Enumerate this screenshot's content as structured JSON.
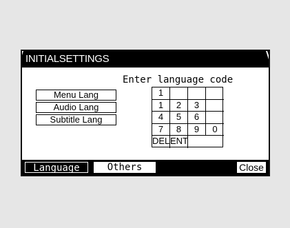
{
  "window": {
    "title": "INITIALSETTINGS"
  },
  "prompt": "Enter language code",
  "language_buttons": [
    {
      "label": "Menu Lang"
    },
    {
      "label": "Audio Lang"
    },
    {
      "label": "Subtitle Lang"
    }
  ],
  "keypad": {
    "rows": [
      [
        "1",
        "",
        "",
        ""
      ],
      [
        "1",
        "2",
        "3",
        ""
      ],
      [
        "4",
        "5",
        "6",
        ""
      ],
      [
        "7",
        "8",
        "9",
        "0"
      ],
      [
        "DEL",
        "ENT"
      ]
    ]
  },
  "tabs": [
    {
      "label": "Language",
      "active": true
    },
    {
      "label": "Others",
      "active": false
    },
    {
      "label": "Close",
      "active": false
    }
  ]
}
